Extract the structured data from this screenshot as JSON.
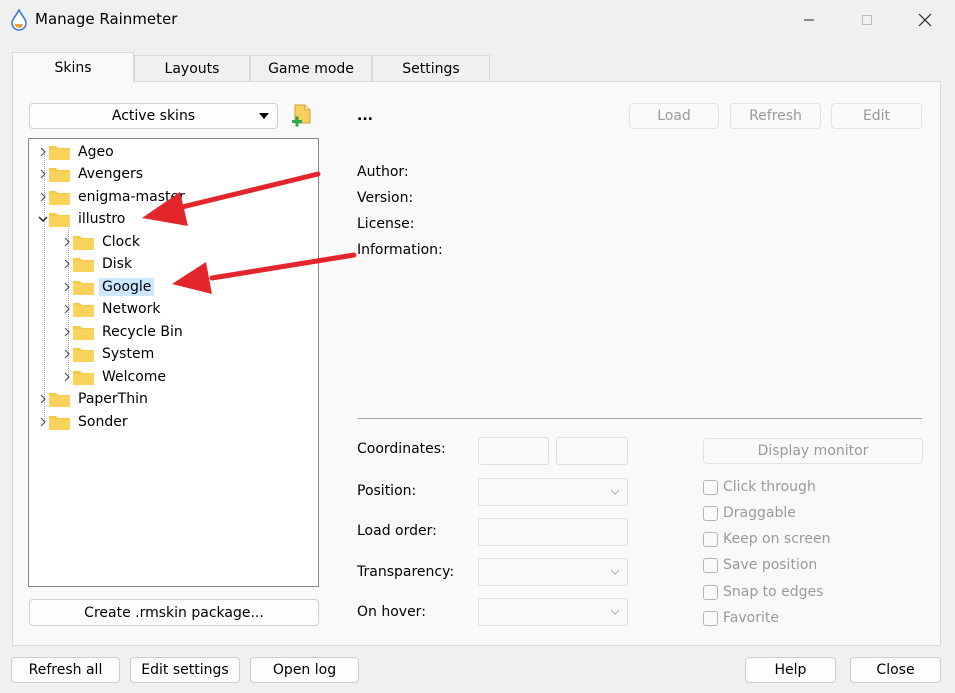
{
  "window": {
    "title": "Manage Rainmeter"
  },
  "tabs": [
    {
      "label": "Skins"
    },
    {
      "label": "Layouts"
    },
    {
      "label": "Game mode"
    },
    {
      "label": "Settings"
    }
  ],
  "skins_panel": {
    "dropdown_label": "Active skins",
    "tree": {
      "roots": [
        {
          "label": "Ageo"
        },
        {
          "label": "Avengers"
        },
        {
          "label": "enigma-master"
        },
        {
          "label": "illustro",
          "expanded": true
        },
        {
          "label": "PaperThin"
        },
        {
          "label": "Sonder"
        }
      ],
      "illustro_children": [
        {
          "label": "Clock"
        },
        {
          "label": "Disk"
        },
        {
          "label": "Google",
          "selected": true
        },
        {
          "label": "Network"
        },
        {
          "label": "Recycle Bin"
        },
        {
          "label": "System"
        },
        {
          "label": "Welcome"
        }
      ]
    },
    "create_package_label": "Create .rmskin package..."
  },
  "details": {
    "skin_name": "...",
    "load_label": "Load",
    "refresh_label": "Refresh",
    "edit_label": "Edit",
    "author_label": "Author:",
    "version_label": "Version:",
    "license_label": "License:",
    "information_label": "Information:",
    "coordinates_label": "Coordinates:",
    "position_label": "Position:",
    "load_order_label": "Load order:",
    "transparency_label": "Transparency:",
    "on_hover_label": "On hover:",
    "display_monitor_label": "Display monitor",
    "checkboxes": [
      {
        "label": "Click through"
      },
      {
        "label": "Draggable"
      },
      {
        "label": "Keep on screen"
      },
      {
        "label": "Save position"
      },
      {
        "label": "Snap to edges"
      },
      {
        "label": "Favorite"
      }
    ]
  },
  "footer": {
    "refresh_all_label": "Refresh all",
    "edit_settings_label": "Edit settings",
    "open_log_label": "Open log",
    "help_label": "Help",
    "close_label": "Close"
  },
  "colors": {
    "annotation_arrow": "#e3262b",
    "folder": "#f7c948",
    "selection": "#cce8ff"
  }
}
